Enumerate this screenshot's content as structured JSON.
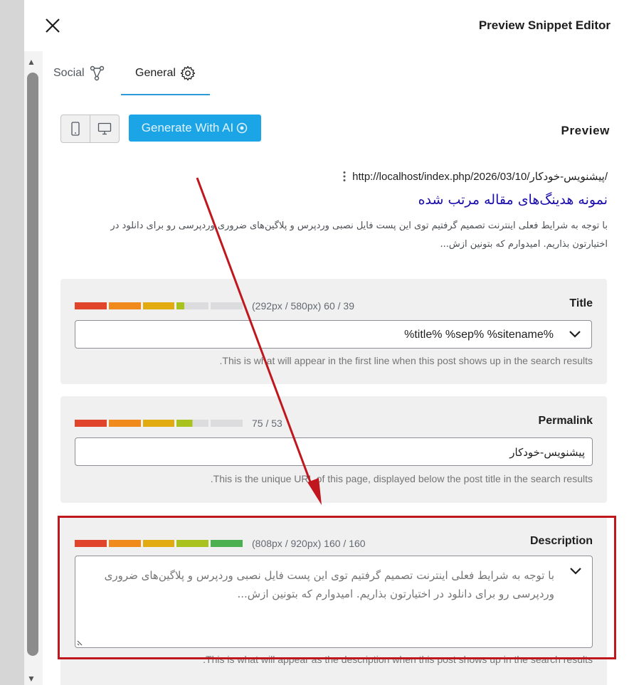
{
  "modal": {
    "title": "Preview Snippet Editor"
  },
  "tabs": [
    {
      "label": "Social"
    },
    {
      "label": "General"
    }
  ],
  "toolbar": {
    "ai_button_label": "Generate With AI"
  },
  "preview": {
    "label": "Preview",
    "url": "http://localhost/index.php/2026/03/10/پیشنویس-خودکار/",
    "title": "نمونه هدینگ‌های مقاله مرتب شده",
    "description": "با توجه به شرایط فعلی اینترنت تصمیم گرفتیم توی این پست فایل نصبی وردپرس و پلاگین‌های ضروری وردپرسی رو برای دانلود در اختیارتون بذاریم. امیدوارم که بتونین ازش..."
  },
  "fields": {
    "title": {
      "label": "Title",
      "counter": "(292px / 580px) 60 / 39",
      "value": "%title% %sep% %sitename%",
      "help": ".This is what will appear in the first line when this post shows up in the search results",
      "progress": 0.65
    },
    "permalink": {
      "label": "Permalink",
      "counter": "75 / 53",
      "value": "پیشنویس-خودکار",
      "help": ".This is the unique URL of this page, displayed below the post title in the search results",
      "progress": 0.7
    },
    "description": {
      "label": "Description",
      "counter": "(808px / 920px) 160 / 160",
      "value": "با توجه به شرایط فعلی اینترنت تصمیم گرفتیم توی این پست فایل نصبی وردپرس و پلاگین‌های ضروری وردپرسی رو برای دانلود در اختیارتون بذاریم. امیدوارم که بتونین ازش...",
      "help": ".This is what will appear as the description when this post shows up in the search results",
      "progress": 1.0
    }
  },
  "colors": {
    "accent": "#2c9ad8",
    "ai_button": "#1ba5e6",
    "serp_title": "#1a0dab",
    "annotation": "#c0171f",
    "progress_segments": [
      "#e0452b",
      "#f08a1c",
      "#e2ab0f",
      "#a9c21d",
      "#4caf50"
    ]
  }
}
